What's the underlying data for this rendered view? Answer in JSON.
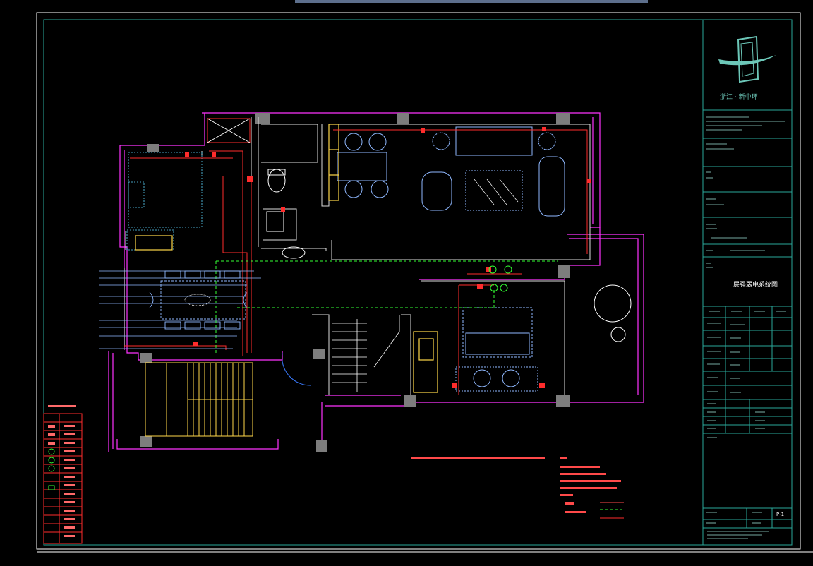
{
  "titleblock": {
    "logo_caption": "浙江 · 新中环",
    "sheet_title": "一层强弱电系统图",
    "sheet_number": "P-1"
  }
}
